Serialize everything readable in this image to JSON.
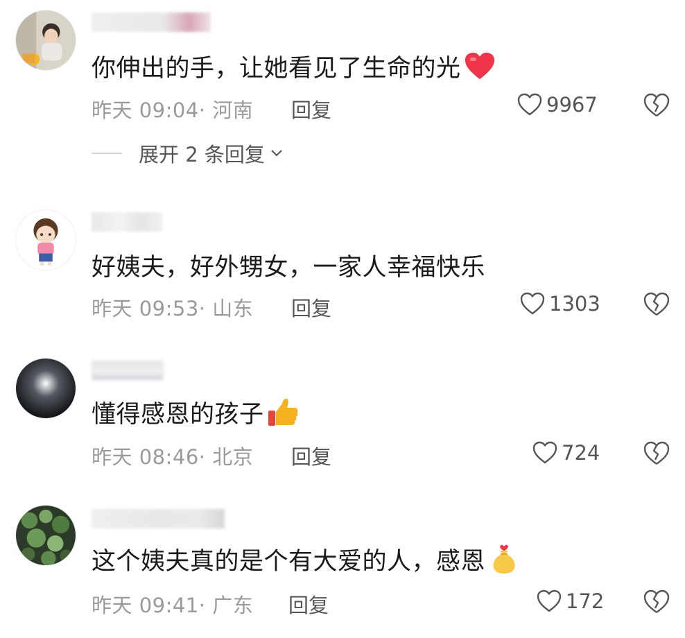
{
  "comments": [
    {
      "text": "你伸出的手，让她看见了生命的光",
      "emoji": "red-heart-icon",
      "time": "昨天 09:04",
      "location": "河南",
      "reply_label": "回复",
      "likes": "9967",
      "expand_label": "展开 2 条回复"
    },
    {
      "text": "好姨夫，好外甥女，一家人幸福快乐",
      "time": "昨天 09:53",
      "location": "山东",
      "reply_label": "回复",
      "likes": "1303"
    },
    {
      "text": "懂得感恩的孩子",
      "emoji": "thumbs-up-icon",
      "time": "昨天 08:46",
      "location": "北京",
      "reply_label": "回复",
      "likes": "724"
    },
    {
      "text": "这个姨夫真的是个有大爱的人，感恩",
      "emoji": "money-bag-icon",
      "time": "昨天 09:41",
      "location": "广东",
      "reply_label": "回复",
      "likes": "172"
    }
  ],
  "separator": "· ",
  "colors": {
    "text": "#1b1b1b",
    "meta": "#9a9a9a",
    "action": "#555555",
    "heart_emoji": "#f0354a",
    "thumbs_emoji": "#f6b21e"
  }
}
